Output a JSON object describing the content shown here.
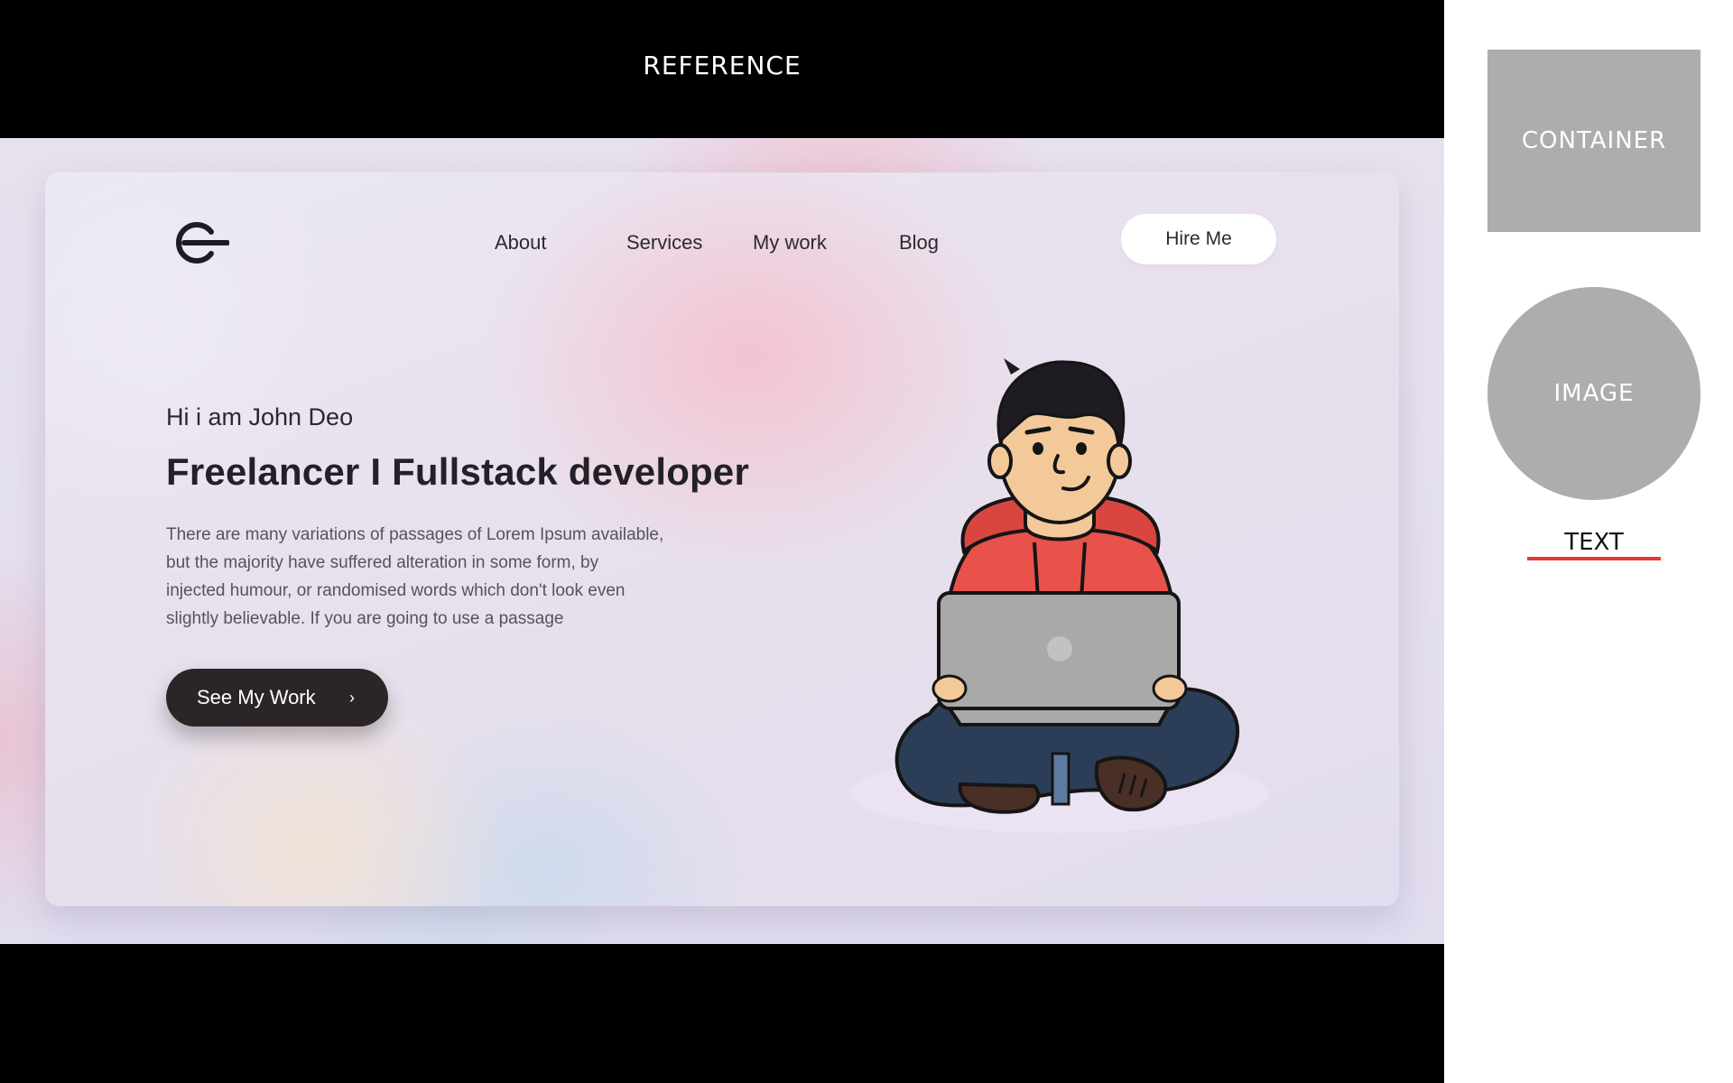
{
  "reference": {
    "title": "REFERENCE"
  },
  "site": {
    "nav": {
      "items": [
        {
          "label": "About"
        },
        {
          "label": "Services"
        },
        {
          "label": "My work"
        },
        {
          "label": "Blog"
        }
      ],
      "hire_label": "Hire Me"
    },
    "hero": {
      "greeting": "Hi i am John Deo",
      "headline": "Freelancer I Fullstack developer",
      "description_lines": [
        "There are many variations of passages of Lorem Ipsum available,",
        "but the majority have suffered alteration in some form, by",
        "injected humour, or randomised words which don't look even",
        "slightly believable. If you are going to use a passage"
      ],
      "cta_label": "See My Work",
      "cta_icon": "chevron-right-icon"
    },
    "illustration": "developer-with-laptop"
  },
  "legend": {
    "container_label": "CONTAINER",
    "image_label": "IMAGE",
    "text_label": "TEXT"
  },
  "colors": {
    "dark_button": "#2c2527",
    "legend_gray": "#adadad",
    "text_underline": "#e53935",
    "hoodie": "#e8524a",
    "laptop": "#a9a9a9",
    "pants": "#2c3e57"
  }
}
